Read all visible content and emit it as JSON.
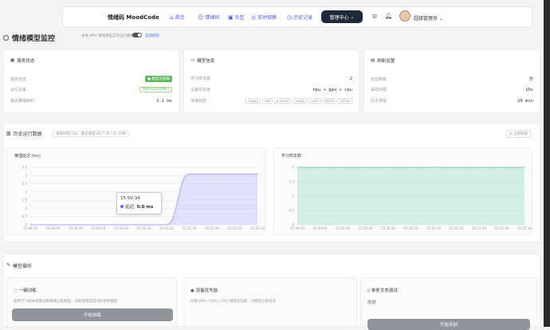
{
  "topbar": {
    "brand": "情绪码 MoodCode",
    "nav": [
      {
        "icon": "home-icon",
        "glyph": "⌂",
        "label": "首页"
      },
      {
        "icon": "emotion-icon",
        "glyph": "☺",
        "label": "情绪码"
      },
      {
        "icon": "community-icon",
        "glyph": "▣",
        "label": "社区"
      },
      {
        "icon": "live-icon",
        "glyph": "◎",
        "label": "实时观察"
      },
      {
        "icon": "history-icon",
        "glyph": "◷",
        "label": "历史记录"
      }
    ],
    "mgmt_label": "管理中心",
    "lang": "中",
    "user": "超级管理员"
  },
  "page": {
    "title": "情绪模型监控",
    "subtitle": "本地 NPU 情绪模型实时运行数据",
    "auto_refresh": "自动刷新"
  },
  "service": {
    "title": "服务状态",
    "rows": [
      {
        "label": "服务状态",
        "value": "模型已加载"
      },
      {
        "label": "运行设备",
        "value": "NPU(DirectML)"
      },
      {
        "label": "最近推理耗时",
        "value": "3.1 ms"
      }
    ]
  },
  "model": {
    "title": "模型信息",
    "rows": [
      {
        "label": "学习样本数",
        "value": "2"
      },
      {
        "label": "设备优先级",
        "value": "npu + gpu + cpu"
      },
      {
        "label": "情绪标签"
      }
    ],
    "tags": [
      "happy",
      "sad",
      "anxious",
      "angry",
      "calm",
      "bored",
      "stress"
    ]
  },
  "settings": {
    "title": "刷新设置",
    "rows": [
      {
        "label": "自动刷新",
        "value": "开"
      },
      {
        "label": "采样间隔",
        "value": "10s"
      },
      {
        "label": "历史保留",
        "value": "20 min"
      }
    ]
  },
  "history": {
    "title": "历史运行数据",
    "subtitle": "采样间隔 10s · 最多保留 60 个点 (10 分钟)",
    "refresh": "立即刷新"
  },
  "chart_data": [
    {
      "type": "area",
      "title": "推理延迟 (ms)",
      "x": [
        "15:49:24",
        "15:49:54",
        "15:50:14",
        "15:50:24",
        "15:50:34",
        "15:50:54",
        "15:51:14",
        "15:51:24",
        "15:51:44",
        "15:52:04",
        "15:52:14"
      ],
      "values": [
        0,
        0,
        0,
        0,
        0,
        0,
        0,
        3.1,
        3.1,
        3.1,
        3.1
      ],
      "ylim": [
        0,
        3.5
      ],
      "yticks": [
        "0",
        "0.5",
        "1",
        "1.5",
        "2",
        "2.5",
        "3",
        "3.5"
      ],
      "color": "#a5a6f6",
      "tooltip": {
        "time": "15:50:34",
        "series": "延迟",
        "value": "0.0 ms"
      }
    },
    {
      "type": "area",
      "title": "学习样本数",
      "x": [
        "15:49:24",
        "15:49:54",
        "15:50:14",
        "15:50:24",
        "15:50:34",
        "15:50:54",
        "15:51:14",
        "15:51:24",
        "15:51:44",
        "15:52:04",
        "15:52:14"
      ],
      "values": [
        2,
        2,
        2,
        2,
        2,
        2,
        2,
        2,
        2,
        2,
        2
      ],
      "ylim": [
        0,
        2
      ],
      "yticks": [
        "0",
        "0.5",
        "1",
        "1.5",
        "2"
      ],
      "color": "#7fcfae"
    }
  ],
  "ops": {
    "title": "模型操作",
    "cards": [
      {
        "icon": "train-icon",
        "title": "一键训练",
        "desc": "使用学习样本增量训练情绪分类模型，训练结束后自动热更新模型",
        "button": "开始训练"
      },
      {
        "icon": "device-icon",
        "title": "设备优先级",
        "desc": "切换 NPU / GPU / CPU 调度优先级，切换后立即生效"
      },
      {
        "icon": "text-icon",
        "title": "单条文本测试",
        "input": "你好",
        "button": "开始识别"
      }
    ]
  }
}
